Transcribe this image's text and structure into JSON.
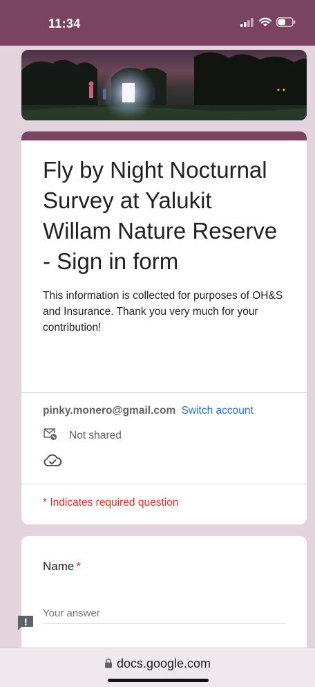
{
  "status_bar": {
    "time": "11:34",
    "icons": [
      "cellular-signal-icon",
      "wifi-icon",
      "battery-icon"
    ]
  },
  "header_image": {
    "description": "night survey scene"
  },
  "form": {
    "accent_color": "#7a4460",
    "title": "Fly by Night Nocturnal Survey at Yalukit Willam Nature Reserve - Sign in form",
    "description": "This information is collected for purposes of OH&S and Insurance. Thank you very much for your contribution!",
    "account": {
      "email": "pinky.monero@gmail.com",
      "switch_label": "Switch account",
      "shared_status": "Not shared"
    },
    "required_note": "* Indicates required question"
  },
  "questions": [
    {
      "label": "Name",
      "required_mark": "*",
      "placeholder": "Your answer",
      "value": ""
    }
  ],
  "browser": {
    "url": "docs.google.com"
  },
  "colors": {
    "status_bar": "#7a4460",
    "page_background": "#e3d3dc",
    "link": "#1a73e8",
    "required": "#d93025"
  }
}
